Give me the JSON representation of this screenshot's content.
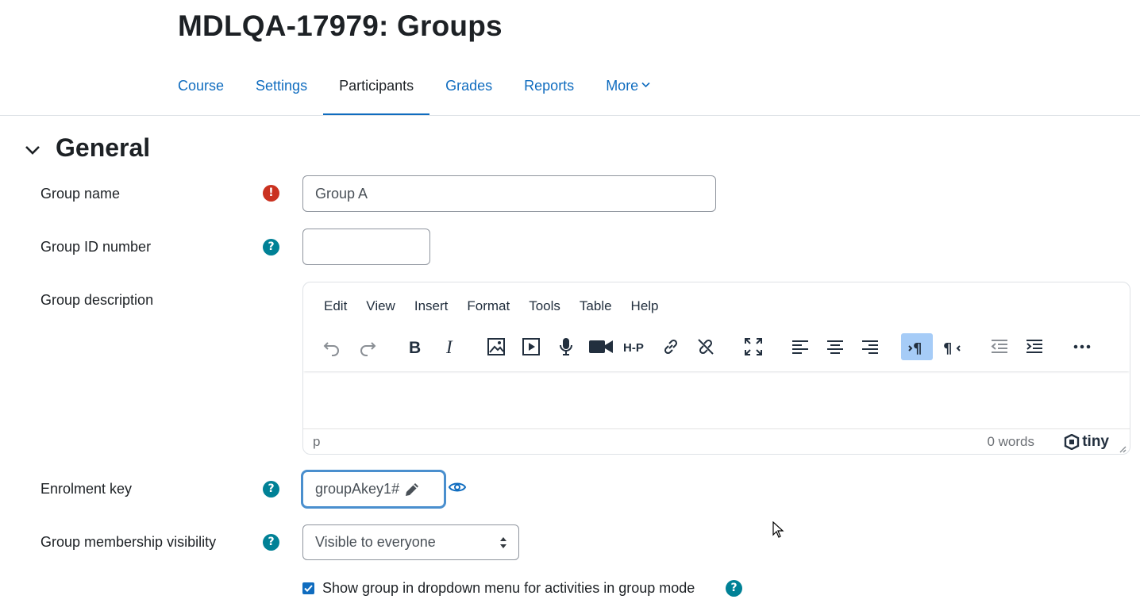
{
  "page": {
    "title": "MDLQA-17979: Groups"
  },
  "nav": {
    "tabs": [
      {
        "label": "Course"
      },
      {
        "label": "Settings"
      },
      {
        "label": "Participants"
      },
      {
        "label": "Grades"
      },
      {
        "label": "Reports"
      },
      {
        "label": "More"
      }
    ],
    "active": "Participants"
  },
  "section": {
    "title": "General",
    "expanded": true
  },
  "form": {
    "group_name": {
      "label": "Group name",
      "value": "Group A",
      "required": true
    },
    "group_id": {
      "label": "Group ID number",
      "value": ""
    },
    "description": {
      "label": "Group description",
      "menu": [
        "Edit",
        "View",
        "Insert",
        "Format",
        "Tools",
        "Table",
        "Help"
      ],
      "toolbar_icons": [
        "undo-icon",
        "redo-icon",
        "bold-icon",
        "italic-icon",
        "image-icon",
        "media-icon",
        "record-audio-icon",
        "record-video-icon",
        "h5p-icon",
        "link-icon",
        "unlink-icon",
        "fullscreen-icon",
        "align-left-icon",
        "align-center-icon",
        "align-right-icon",
        "ltr-icon",
        "rtl-icon",
        "outdent-icon",
        "indent-icon",
        "more-icon"
      ],
      "status_path": "p",
      "word_count": "0 words",
      "brand": "tiny"
    },
    "enrolment_key": {
      "label": "Enrolment key",
      "value": "groupAkey1#"
    },
    "visibility": {
      "label": "Group membership visibility",
      "value": "Visible to everyone"
    },
    "show_in_dropdown": {
      "label": "Show group in dropdown menu for activities in group mode",
      "checked": true
    }
  },
  "colors": {
    "link": "#0f6cbf",
    "required": "#ca3120",
    "help": "#008196",
    "focus": "#4a8fce",
    "active_button": "#a6ccf7"
  }
}
